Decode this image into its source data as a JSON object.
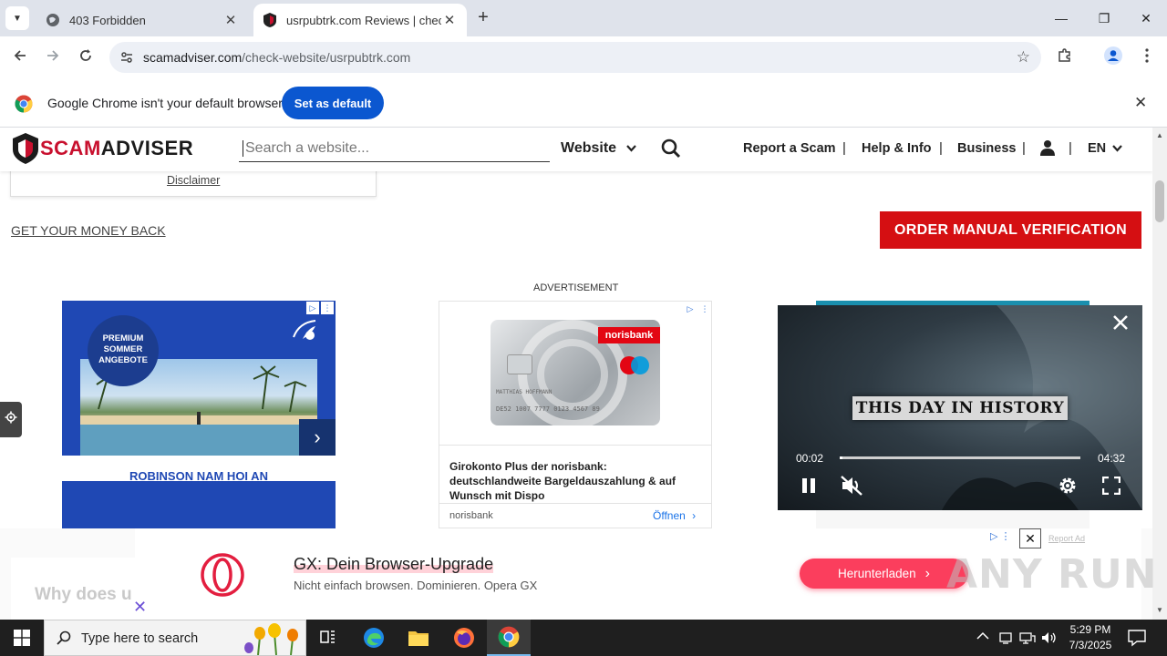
{
  "browser": {
    "tabs": [
      {
        "title": "403 Forbidden",
        "close": "✕"
      },
      {
        "title": "usrpubtrk.com Reviews | check",
        "close": "✕"
      }
    ],
    "new_tab": "+",
    "window_controls": {
      "minimize": "—",
      "maximize": "❐",
      "close": "✕"
    },
    "url_domain": "scamadviser.com",
    "url_path": "/check-website/usrpubtrk.com",
    "infobar": {
      "message": "Google Chrome isn't your default browser",
      "button": "Set as default",
      "close": "✕"
    }
  },
  "site": {
    "logo_scam": "SCAM",
    "logo_adviser": "ADVISER",
    "search_placeholder": "Search a website...",
    "search_type": "Website",
    "nav": [
      "Report a Scam",
      "Help & Info",
      "Business"
    ],
    "separator": "|",
    "language": "EN",
    "disclaimer": "Disclaimer",
    "money_back": "GET YOUR MONEY BACK",
    "order_button": "ORDER MANUAL VERIFICATION",
    "ad_label": "ADVERTISEMENT",
    "why_does": "Why does u"
  },
  "ads": {
    "left": {
      "badge_lines": [
        "PREMIUM",
        "SOMMER",
        "ANGEBOTE"
      ],
      "name": "ROBINSON NAM HOI AN",
      "next": "›"
    },
    "middle": {
      "card_brand": "norisbank",
      "card_holder": "MATTHIAS HOFFMANN",
      "card_number": "DE52 1007 7777 0123 4567 89",
      "headline": "Girokonto Plus der norisbank: deutschlandweite Bargeldauszahlung & auf Wunsch mit Dispo",
      "advertiser": "norisbank",
      "cta": "Öffnen"
    },
    "video": {
      "title_card": "THIS DAY IN HISTORY",
      "time_current": "00:02",
      "time_total": "04:32",
      "progress": 0.01
    },
    "sticky": {
      "headline_highlight": "GX: Dein Browser-Upgrade",
      "subline": "Nicht einfach browsen. Dominieren. Opera GX",
      "cta": "Herunterladen",
      "close": "✕",
      "report": "Report Ad"
    }
  },
  "watermark": "ANY RUN",
  "taskbar": {
    "search_placeholder": "Type here to search",
    "time": "5:29 PM",
    "date": "7/3/2025"
  },
  "colors": {
    "brand_red": "#d50f12",
    "chrome_blue": "#0b57d0",
    "opera_cta": "#fb3e5d"
  }
}
